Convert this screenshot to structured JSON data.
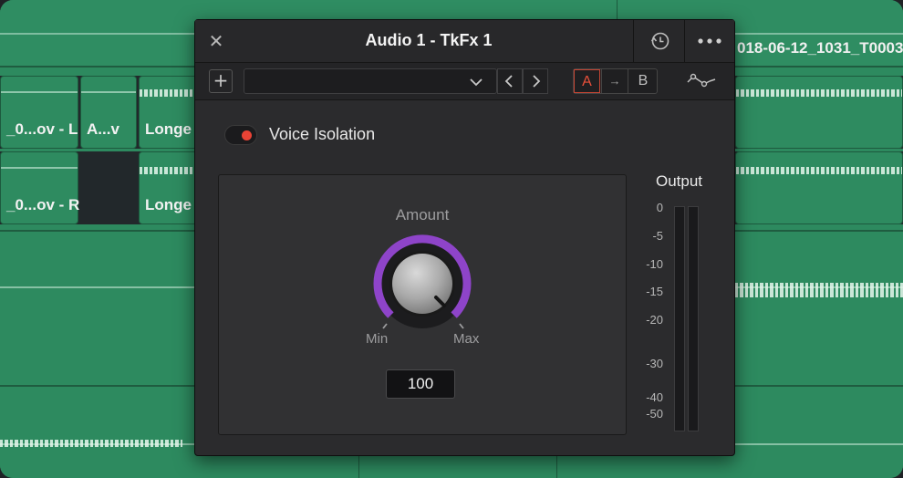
{
  "timeline": {
    "top_clip_name": "018-06-12_1031_T0003",
    "clips": [
      {
        "label": "_0...ov - L"
      },
      {
        "label": "A...v"
      },
      {
        "label": "Longe"
      },
      {
        "label": "_0...ov - R"
      },
      {
        "label": "Longe"
      }
    ]
  },
  "window": {
    "title": "Audio 1 - TkFx 1",
    "close_icon": "close-icon",
    "history_icon": "history-icon",
    "more_icon": "more-icon"
  },
  "toolbar": {
    "add_label": "+",
    "preset_value": "",
    "compare": {
      "a": "A",
      "arrow": "→",
      "b": "B"
    },
    "curve_icon": "curve-icon"
  },
  "voice_isolation": {
    "label": "Voice Isolation",
    "enabled": true,
    "indicator_color": "#ea4335"
  },
  "amount": {
    "label": "Amount",
    "min_label": "Min",
    "max_label": "Max",
    "value": "100",
    "ring_color": "#8e44c9"
  },
  "output": {
    "label": "Output",
    "scale": [
      "0",
      "-5",
      "-10",
      "-15",
      "-20",
      "-30",
      "-40",
      "-50"
    ]
  }
}
